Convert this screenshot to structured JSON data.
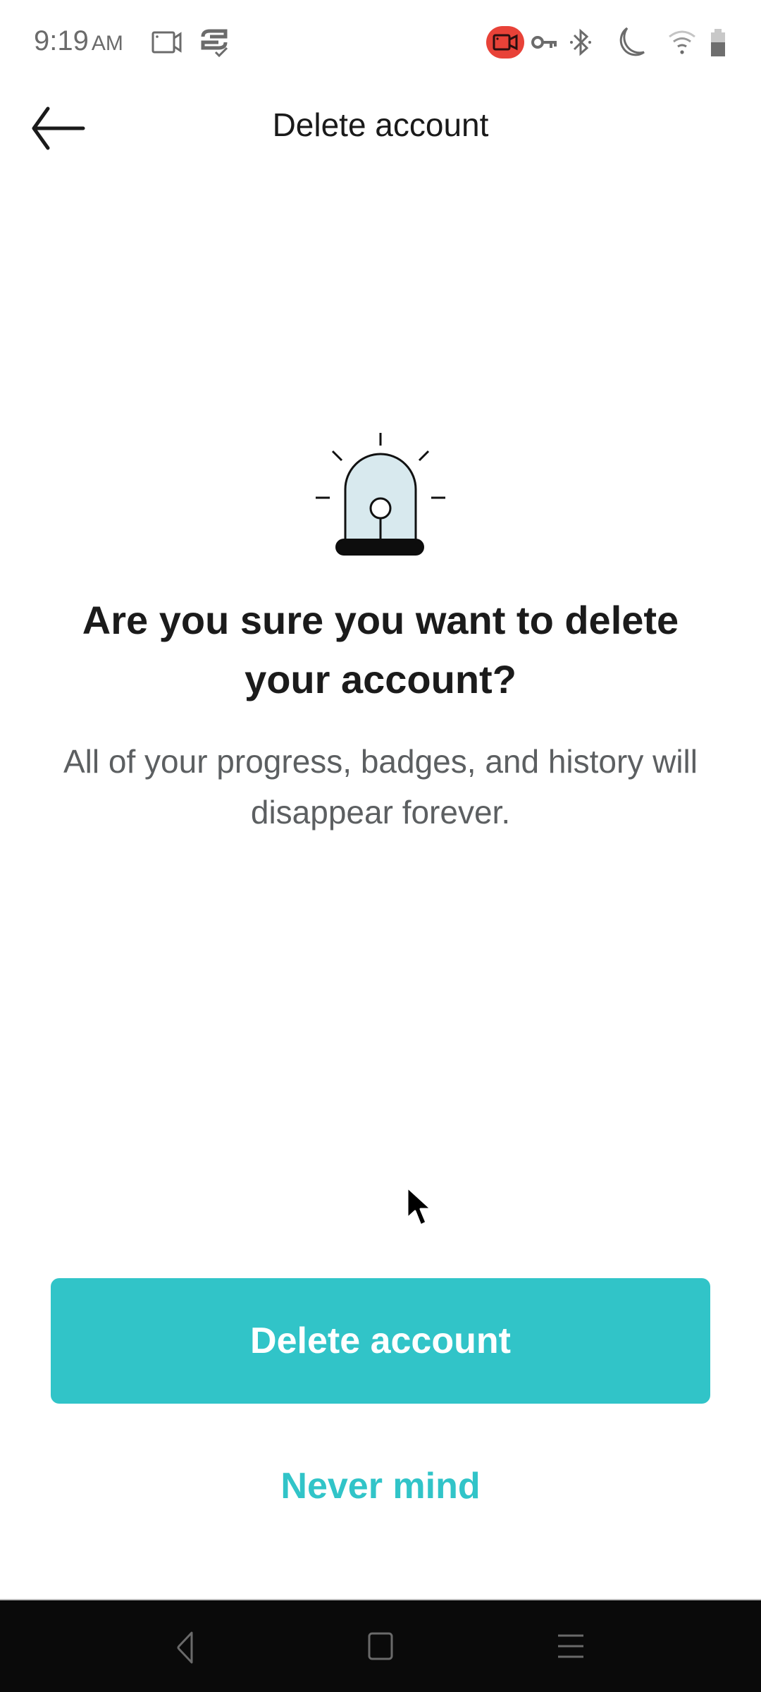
{
  "status_bar": {
    "time": "9:19",
    "ampm": "AM",
    "left_icons": [
      "screen-record-icon",
      "sync-icon"
    ],
    "right_icons": [
      "recording-badge-icon",
      "vpn-key-icon",
      "bluetooth-icon",
      "do-not-disturb-moon-icon",
      "wifi-icon",
      "battery-icon"
    ],
    "recording_color": "#e84238"
  },
  "app_bar": {
    "back_icon": "arrow-left-icon",
    "title": "Delete account"
  },
  "content": {
    "illustration_icon": "siren-alarm-icon",
    "heading": "Are you sure you want to delete your account?",
    "body": "All of your progress, badges, and history will disappear forever."
  },
  "actions": {
    "primary_label": "Delete account",
    "secondary_label": "Never mind",
    "accent_color": "#31c4c8"
  },
  "nav_bar": {
    "buttons": [
      "back-triangle-icon",
      "home-square-icon",
      "menu-lines-icon"
    ]
  }
}
